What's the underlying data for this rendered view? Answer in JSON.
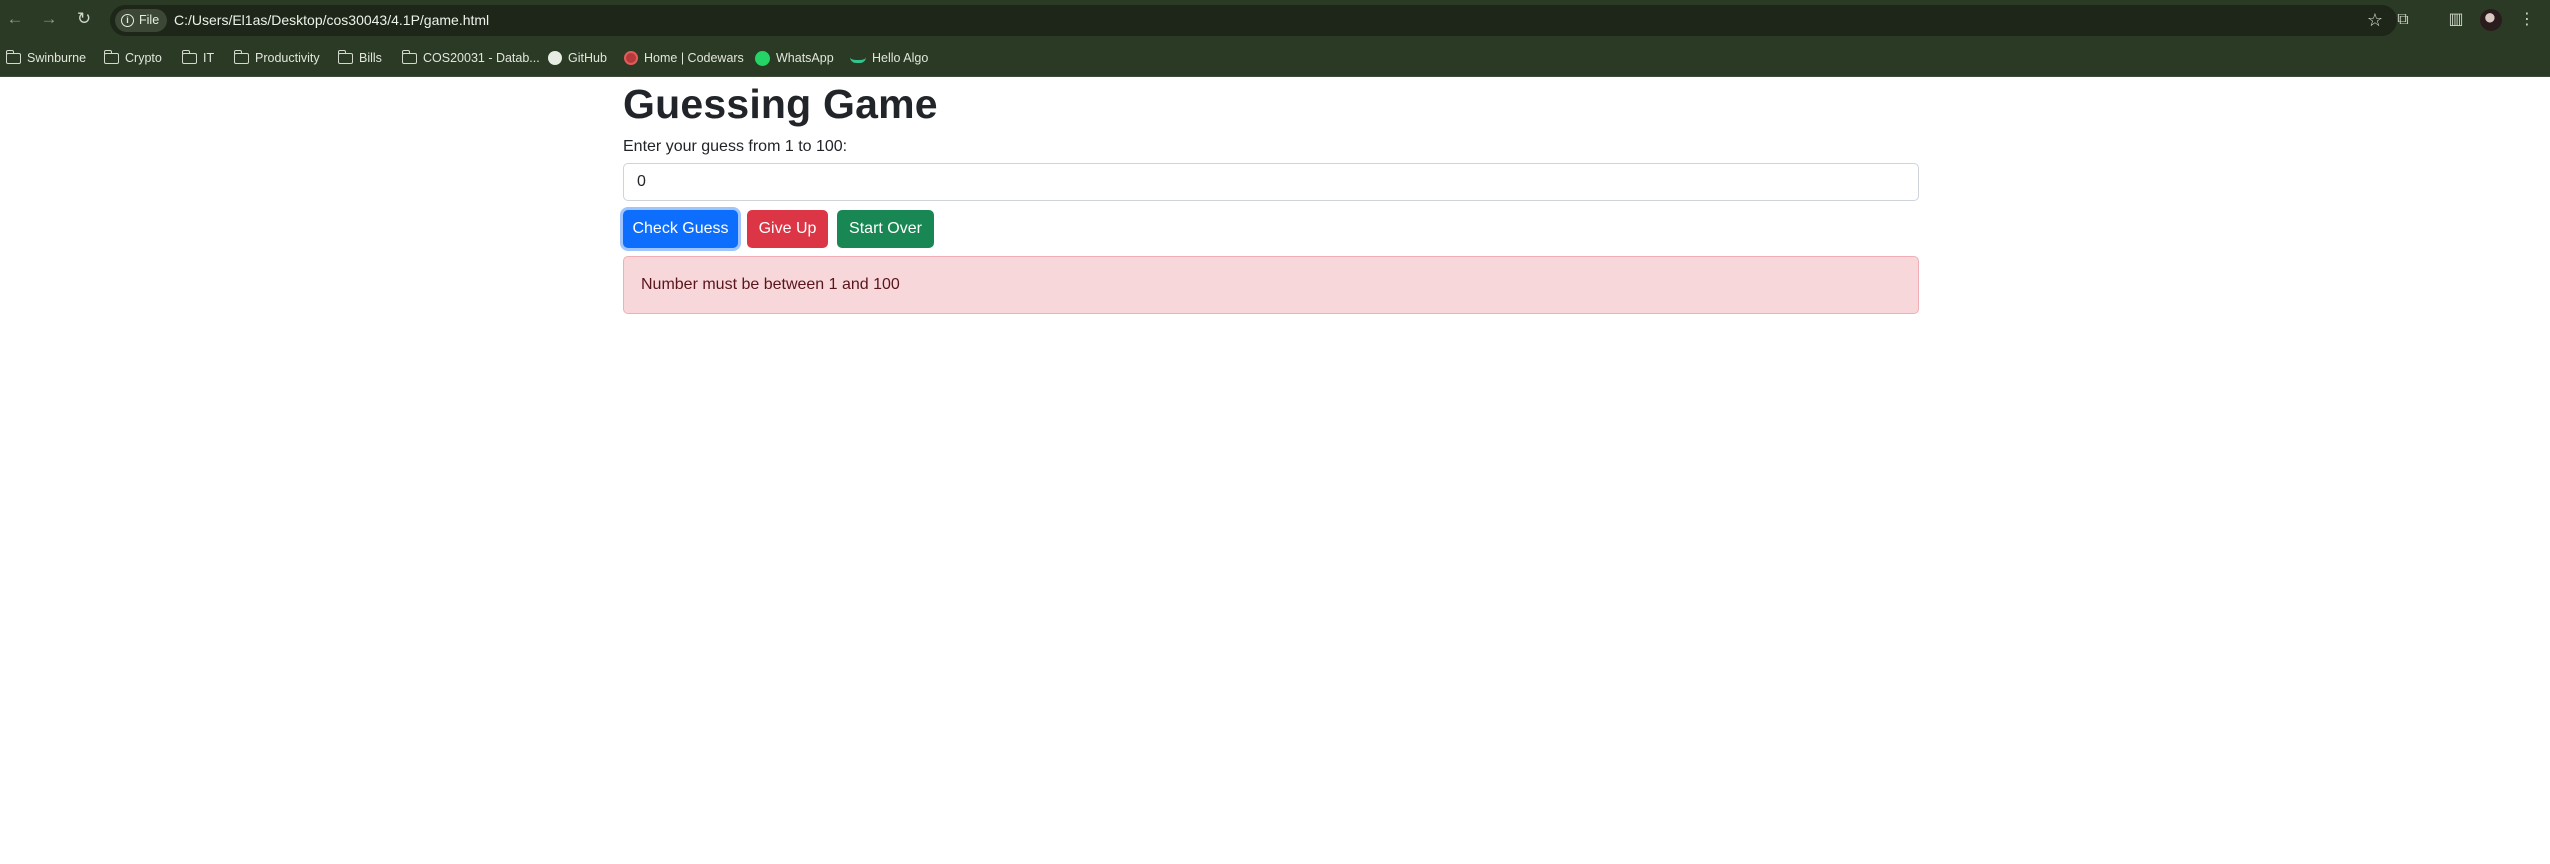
{
  "browser": {
    "site_chip": "File",
    "url": "C:/Users/El1as/Desktop/cos30043/4.1P/game.html",
    "bookmarks": [
      "Swinburne",
      "Crypto",
      "IT",
      "Productivity",
      "Bills",
      "COS20031 - Datab...",
      "GitHub",
      "Home | Codewars",
      "WhatsApp",
      "Hello Algo"
    ]
  },
  "page": {
    "title": "Guessing Game",
    "prompt_label": "Enter your guess from 1 to 100:",
    "guess_value": "0",
    "buttons": {
      "check": "Check Guess",
      "give_up": "Give Up",
      "start_over": "Start Over"
    },
    "alert_message": "Number must be between 1 and 100"
  },
  "colors": {
    "primary": "#0d6efd",
    "danger": "#dc3545",
    "success": "#198754",
    "alert_bg": "#f8d7da",
    "chrome_bg": "#2b3a24"
  }
}
